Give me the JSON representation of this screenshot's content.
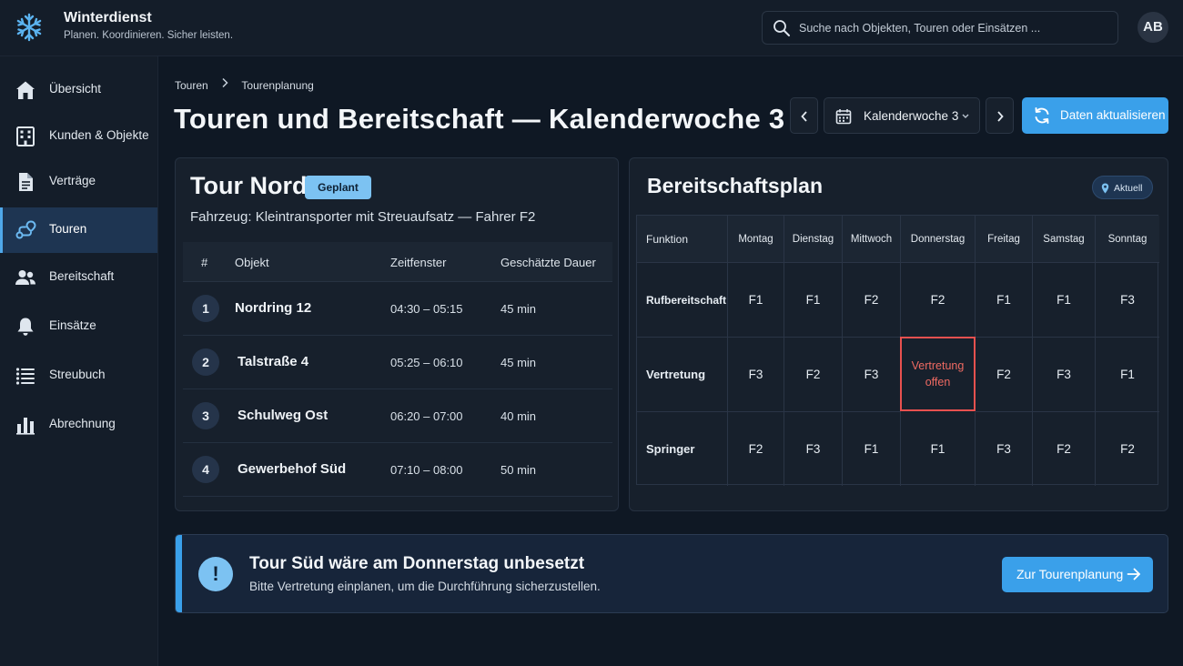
{
  "app": {
    "title": "Winterdienst",
    "subtitle": "Planen. Koordinieren. Sicher leisten.",
    "logo_icon": "snowflake-icon",
    "accent": "#3aa0ea"
  },
  "search": {
    "placeholder": "Suche nach Objekten, Touren oder Einsätzen ..."
  },
  "user": {
    "initials": "AB"
  },
  "sidebar": {
    "items": [
      {
        "label": "Übersicht",
        "icon": "home-icon",
        "active": false
      },
      {
        "label": "Kunden & Objekte",
        "icon": "building-icon",
        "active": false
      },
      {
        "label": "Verträge",
        "icon": "document-icon",
        "active": false
      },
      {
        "label": "Touren",
        "icon": "route-icon",
        "active": true
      },
      {
        "label": "Bereitschaft",
        "icon": "people-icon",
        "active": false
      },
      {
        "label": "Einsätze",
        "icon": "bell-icon",
        "active": false
      },
      {
        "label": "Streubuch",
        "icon": "list-icon",
        "active": false
      },
      {
        "label": "Abrechnung",
        "icon": "bar-chart-icon",
        "active": false
      }
    ]
  },
  "breadcrumb": {
    "items": [
      "Touren",
      "Tourenplanung"
    ]
  },
  "header": {
    "title": "Touren und Bereitschaft — Kalenderwoche 3",
    "week_label": "Kalenderwoche 3",
    "refresh_label": "Daten aktualisieren"
  },
  "tour": {
    "name": "Tour Nord",
    "status": "Geplant",
    "vehicle": "Fahrzeug: Kleintransporter mit Streuaufsatz — Fahrer F2",
    "columns": [
      "#",
      "Objekt",
      "Zeitfenster",
      "Geschätzte Dauer"
    ],
    "rows": [
      {
        "num": "1",
        "object": "Nordring 12",
        "window": "04:30 – 05:15",
        "duration": "45 min"
      },
      {
        "num": "2",
        "object": "Talstraße 4",
        "window": "05:25 – 06:10",
        "duration": "45 min"
      },
      {
        "num": "3",
        "object": "Schulweg Ost",
        "window": "06:20 – 07:00",
        "duration": "40 min"
      },
      {
        "num": "4",
        "object": "Gewerbehof Süd",
        "window": "07:10 – 08:00",
        "duration": "50 min"
      }
    ]
  },
  "plan": {
    "title": "Bereitschaftsplan",
    "badge": "Aktuell",
    "function_header": "Funktion",
    "days": [
      "Montag",
      "Dienstag",
      "Mittwoch",
      "Donnerstag",
      "Freitag",
      "Samstag",
      "Sonntag"
    ],
    "rows": [
      {
        "function": "Rufbereitschaft",
        "cells": [
          "F1",
          "F1",
          "F2",
          "F2",
          "F1",
          "F1",
          "F3"
        ]
      },
      {
        "function": "Vertretung",
        "cells": [
          "F3",
          "F2",
          "F3",
          "Vertretung offen",
          "F2",
          "F3",
          "F1"
        ]
      },
      {
        "function": "Springer",
        "cells": [
          "F2",
          "F3",
          "F1",
          "F1",
          "F3",
          "F2",
          "F2"
        ]
      }
    ],
    "open_color": "#e8514f"
  },
  "alert": {
    "title": "Tour Süd wäre am Donnerstag unbesetzt",
    "text": "Bitte Vertretung einplanen, um die Durchführung sicherzustellen.",
    "button": "Zur Tourenplanung",
    "icon": "exclamation-icon"
  }
}
